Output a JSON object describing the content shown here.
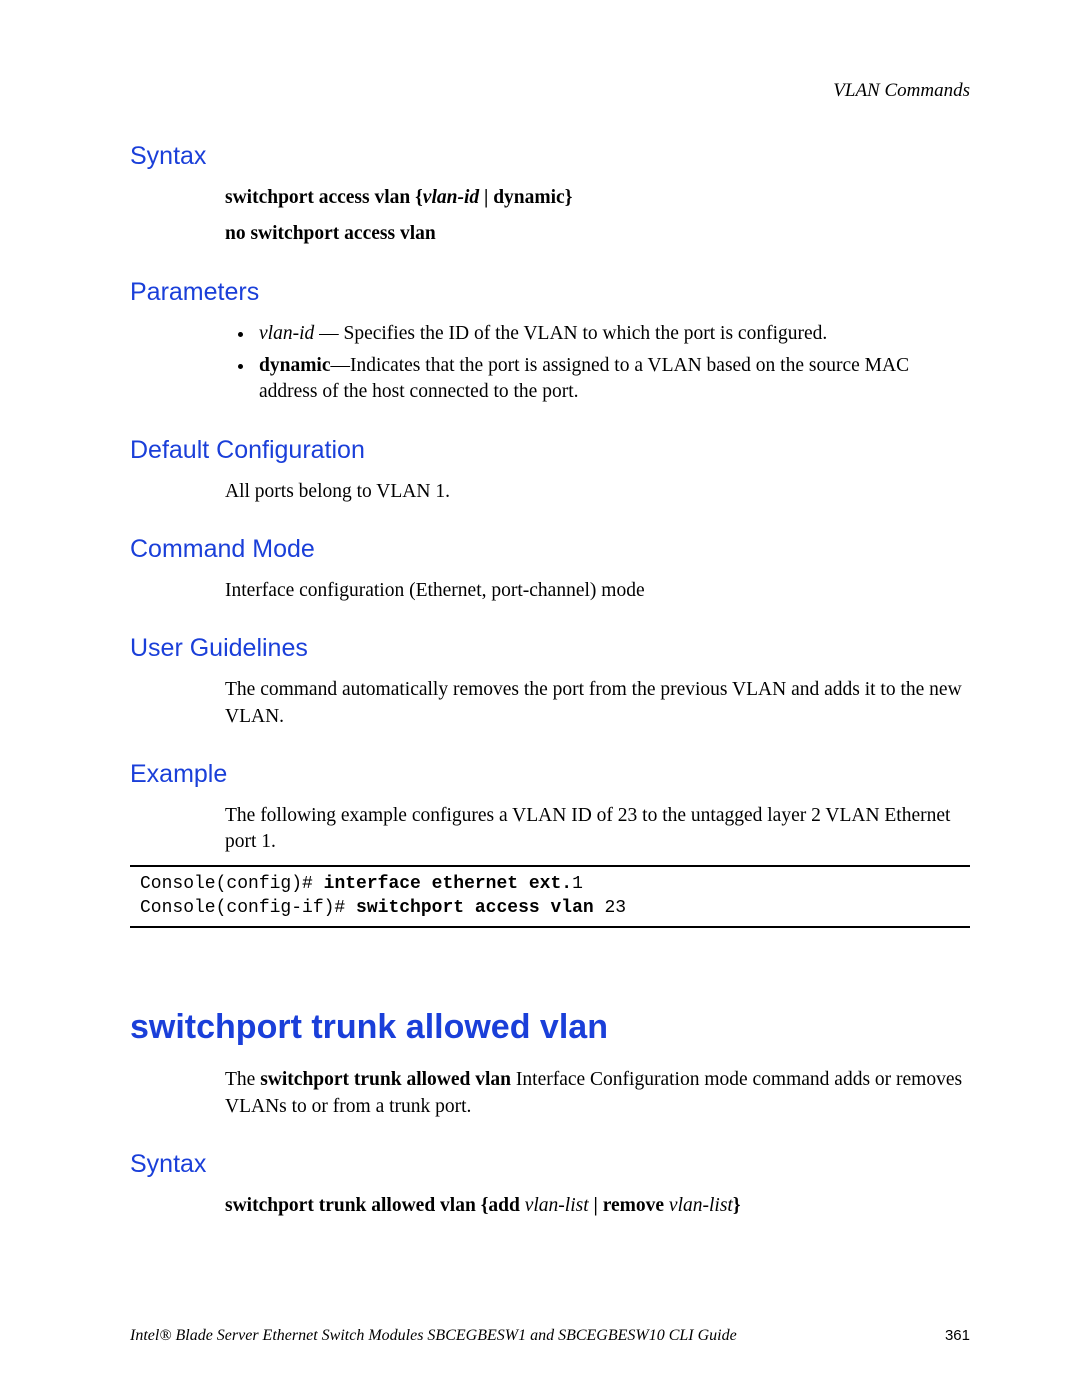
{
  "header": {
    "chapter": "VLAN Commands"
  },
  "sec1": {
    "syntax_h": "Syntax",
    "syntax_line1_cmd": "switchport access vlan",
    "syntax_line1_arg": "vlan-id",
    "syntax_line1_sep": " | ",
    "syntax_line1_opt": "dynamic",
    "syntax_line2": "no switchport access vlan",
    "params_h": "Parameters",
    "param1_term": "vlan-id",
    "param1_desc": " — Specifies the ID of the VLAN to which the port is configured.",
    "param2_term": "dynamic",
    "param2_desc": "—Indicates that the port is assigned to a VLAN based on the source MAC address of the host connected to the port.",
    "default_h": "Default Configuration",
    "default_body": "All ports belong to VLAN 1.",
    "mode_h": "Command Mode",
    "mode_body": "Interface configuration (Ethernet, port-channel) mode",
    "guidelines_h": "User Guidelines",
    "guidelines_body": "The command automatically removes the port from the previous VLAN and adds it to the new VLAN.",
    "example_h": "Example",
    "example_body": "The following example configures a VLAN ID of 23 to the untagged layer 2 VLAN Ethernet port 1.",
    "code_prompt1": "Console(config)# ",
    "code_cmd1": "interface ethernet ext.",
    "code_arg1": "1",
    "code_prompt2": "Console(config-if)# ",
    "code_cmd2": "switchport access vlan ",
    "code_arg2": "23"
  },
  "sec2": {
    "title": "switchport trunk allowed vlan",
    "intro_pre": "The ",
    "intro_bold": "switchport trunk allowed vlan",
    "intro_post": " Interface Configuration mode command adds or removes VLANs to or from a trunk port.",
    "syntax_h": "Syntax",
    "syn_cmd": "switchport trunk allowed vlan",
    "syn_open": " {",
    "syn_add": "add",
    "syn_space": " ",
    "syn_list1": "vlan-list",
    "syn_sep": " | ",
    "syn_remove": "remove",
    "syn_list2": "vlan-list",
    "syn_close": "}"
  },
  "footer": {
    "title": "Intel® Blade Server Ethernet Switch Modules SBCEGBESW1 and SBCEGBESW10 CLI Guide",
    "page": "361"
  }
}
